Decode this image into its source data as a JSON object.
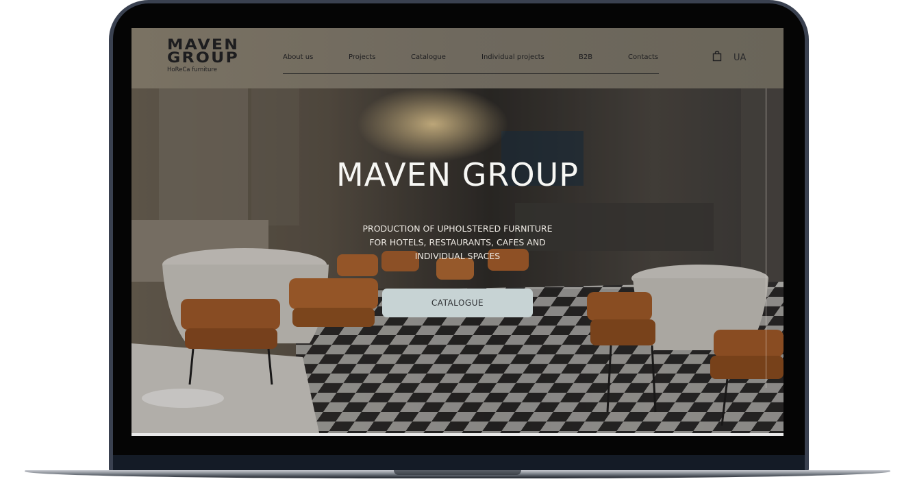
{
  "site": {
    "logo_line1": "MAVEN",
    "logo_line2": "GROUP",
    "logo_tagline": "HoReCa furniture"
  },
  "nav": {
    "items": [
      {
        "label": "About us"
      },
      {
        "label": "Projects"
      },
      {
        "label": "Catalogue"
      },
      {
        "label": "Individual projects"
      },
      {
        "label": "B2B"
      },
      {
        "label": "Contacts"
      }
    ]
  },
  "header_tools": {
    "bag_icon": "shopping-bag-icon",
    "language": "UA"
  },
  "hero": {
    "title": "MAVEN GROUP",
    "subtitle_lines": [
      "PRODUCTION OF UPHOLSTERED FURNITURE",
      "FOR HOTELS, RESTAURANTS, CAFES AND",
      "INDIVIDUAL SPACES"
    ],
    "cta_label": "CATALOGUE",
    "background": "restaurant-interior-photo"
  },
  "colors": {
    "header_bg": "#6f695e",
    "cta_bg": "#c7d3d4",
    "laptop_frame": "#3a4150",
    "text_dark": "#1d1d1f"
  }
}
